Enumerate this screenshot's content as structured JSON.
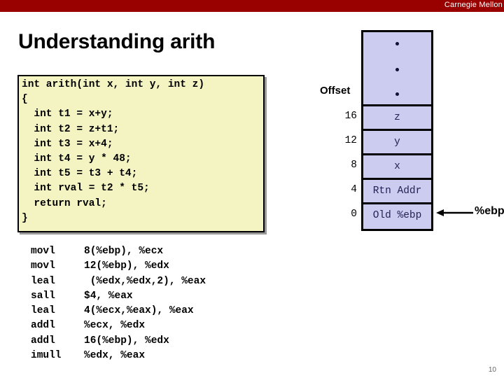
{
  "banner": {
    "institution": "Carnegie Mellon",
    "color": "#990000"
  },
  "title": "Understanding arith",
  "code": {
    "language": "c",
    "background": "#f4f4c3",
    "text": "int arith(int x, int y, int z)\n{\n  int t1 = x+y;\n  int t2 = z+t1;\n  int t3 = x+4;\n  int t4 = y * 48;\n  int t5 = t3 + t4;\n  int rval = t2 * t5;\n  return rval;\n}"
  },
  "assembly": {
    "rows": [
      {
        "op": "movl",
        "args": "8(%ebp), %ecx"
      },
      {
        "op": "movl",
        "args": "12(%ebp), %edx"
      },
      {
        "op": "leal",
        "args": " (%edx,%edx,2), %eax"
      },
      {
        "op": "sall",
        "args": "$4, %eax"
      },
      {
        "op": "leal",
        "args": "4(%ecx,%eax), %eax"
      },
      {
        "op": "addl",
        "args": "%ecx, %edx"
      },
      {
        "op": "addl",
        "args": "16(%ebp), %edx"
      },
      {
        "op": "imull",
        "args": "%edx, %eax"
      }
    ]
  },
  "stack": {
    "offset_label": "Offset",
    "cell_color": "#ccccf0",
    "dots": [
      "•",
      "•",
      "•"
    ],
    "rows": [
      {
        "offset": "16",
        "value": "z"
      },
      {
        "offset": "12",
        "value": "y"
      },
      {
        "offset": "8",
        "value": "x"
      },
      {
        "offset": "4",
        "value": "Rtn Addr"
      },
      {
        "offset": "0",
        "value": "Old %ebp"
      }
    ],
    "pointer_label": "%ebp"
  },
  "page_number": "10"
}
